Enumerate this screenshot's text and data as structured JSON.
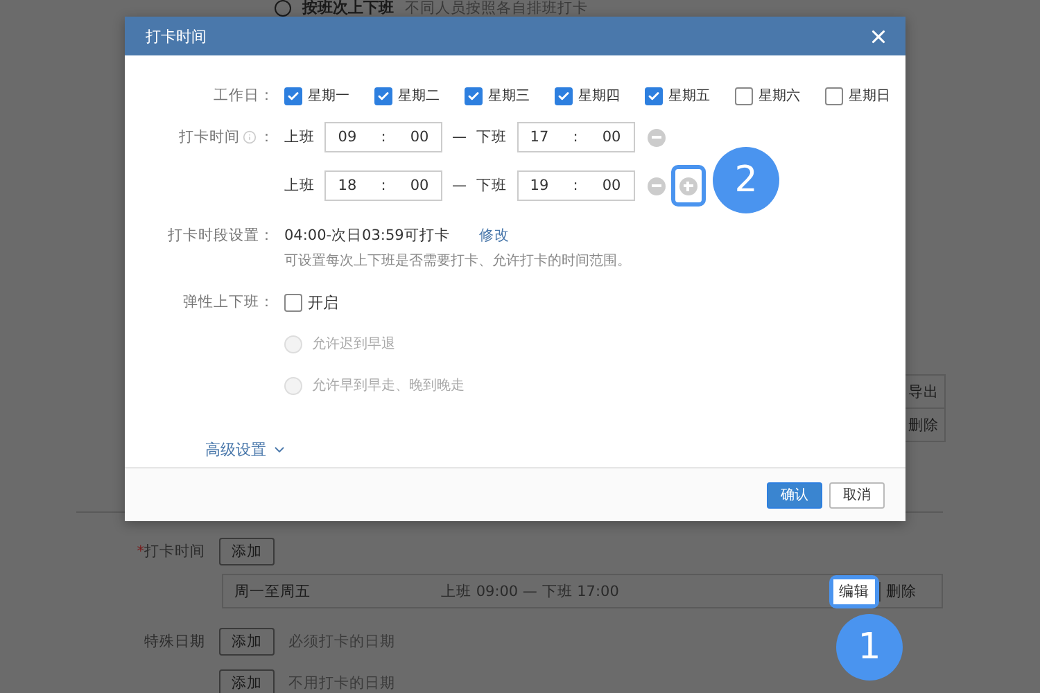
{
  "background": {
    "top_option": {
      "label": "按班次上下班",
      "note": "不同人员按照各自排班打卡",
      "selected": false
    },
    "table_actions": [
      "导出",
      "删除"
    ],
    "punch_time": {
      "label": "打卡时间",
      "required_mark": "*",
      "add_button": "添加",
      "schedule": {
        "days": "周一至周五",
        "times": "上班 09:00 — 下班 17:00",
        "edit_button": "编辑",
        "edit_highlighted": true,
        "delete_button": "删除"
      }
    },
    "special_dates": [
      {
        "label": "特殊日期",
        "add_button": "添加",
        "note": "必须打卡的日期"
      },
      {
        "add_button": "添加",
        "note": "不用打卡的日期"
      }
    ]
  },
  "dialog": {
    "title": "打卡时间",
    "workdays": {
      "label": "工作日：",
      "days": [
        {
          "label": "星期一",
          "checked": true
        },
        {
          "label": "星期二",
          "checked": true
        },
        {
          "label": "星期三",
          "checked": true
        },
        {
          "label": "星期四",
          "checked": true
        },
        {
          "label": "星期五",
          "checked": true
        },
        {
          "label": "星期六",
          "checked": false
        },
        {
          "label": "星期日",
          "checked": false
        }
      ]
    },
    "punch_times": {
      "label": "打卡时间",
      "colon": "：",
      "shifts": [
        {
          "on_label": "上班",
          "on": {
            "hours": "09",
            "sep": ":",
            "minutes": "00"
          },
          "dash": "—",
          "off_label": "下班",
          "off": {
            "hours": "17",
            "sep": ":",
            "minutes": "00"
          },
          "add": false
        },
        {
          "on_label": "上班",
          "on": {
            "hours": "18",
            "sep": ":",
            "minutes": "00"
          },
          "dash": "—",
          "off_label": "下班",
          "off": {
            "hours": "19",
            "sep": ":",
            "minutes": "00"
          },
          "add": true,
          "add_highlighted": true
        }
      ]
    },
    "period": {
      "label": "打卡时段设置：",
      "value": "04:00-次日03:59可打卡",
      "link": "修改",
      "hint": "可设置每次上下班是否需要打卡、允许打卡的时间范围。"
    },
    "flexible": {
      "label": "弹性上下班：",
      "option": "开启",
      "checked": false,
      "modes": [
        {
          "label": "允许迟到早退",
          "selected": false,
          "disabled": true
        },
        {
          "label": "允许早到早走、晚到晚走",
          "selected": false,
          "disabled": true
        }
      ]
    },
    "advanced": {
      "label": "高级设置",
      "expanded": false
    },
    "buttons": [
      {
        "label": "确认",
        "kind": "primary"
      },
      {
        "label": "取消",
        "kind": "default"
      }
    ]
  },
  "callouts": [
    {
      "label": "2"
    },
    {
      "label": "1"
    }
  ]
}
